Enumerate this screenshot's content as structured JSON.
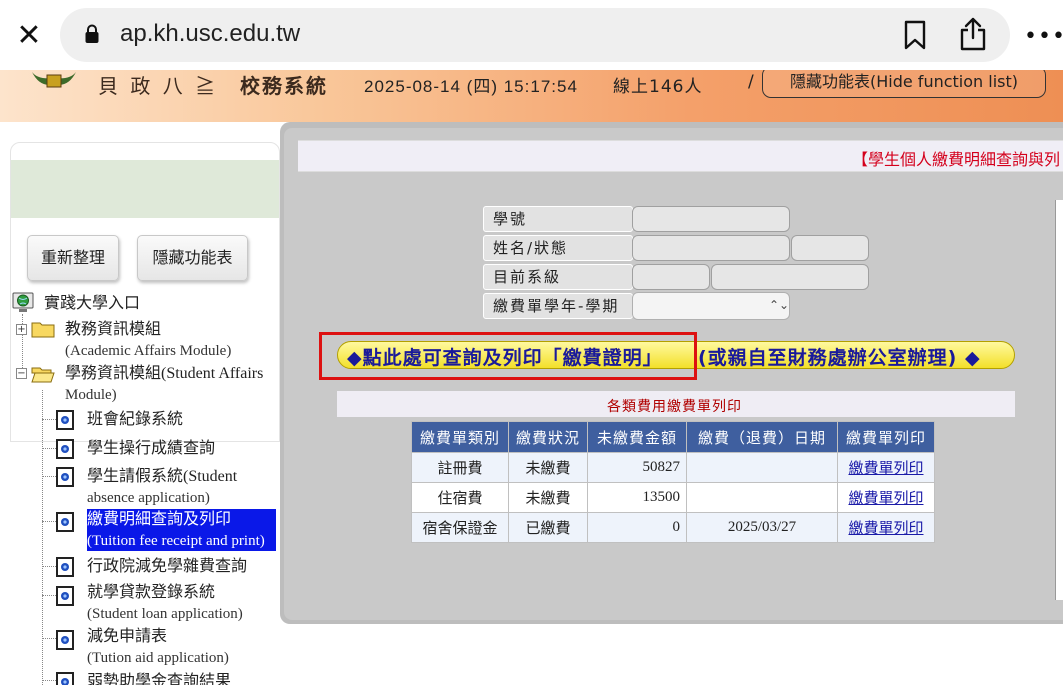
{
  "browser": {
    "url": "ap.kh.usc.edu.tw",
    "close_glyph": "✕",
    "more_glyph": "•••"
  },
  "header": {
    "logo_script": "貝 政 八 ≧",
    "system_name": "校務系統",
    "datetime": "2025-08-14 (四) 15:17:54",
    "online": "線上146人",
    "slash": "/",
    "hide_function_button": "隱藏功能表(Hide function list)"
  },
  "sidebar": {
    "refresh_button": "重新整理",
    "hide_button": "隱藏功能表",
    "root": "實踐大學入口",
    "academic_module": {
      "zh": "教務資訊模組",
      "en": "(Academic Affairs Module)"
    },
    "student_module": {
      "zh": "學務資訊模組(Student Affairs",
      "en": "Module)"
    },
    "items": [
      {
        "zh": "班會紀錄系統",
        "en": ""
      },
      {
        "zh": "學生操行成績查詢",
        "en": ""
      },
      {
        "zh": "學生請假系統(Student",
        "en": "absence application)"
      },
      {
        "zh": "繳費明細查詢及列印",
        "en": "(Tuition fee receipt and print)"
      },
      {
        "zh": "行政院減免學雜費查詢",
        "en": ""
      },
      {
        "zh": "就學貸款登錄系統",
        "en": "(Student loan application)"
      },
      {
        "zh": "減免申請表",
        "en": "(Tution aid application)"
      },
      {
        "zh": "弱勢助學金查詢結果",
        "en": ""
      }
    ]
  },
  "main": {
    "page_title": "【學生個人繳費明細查詢與列",
    "form": {
      "student_id_label": "學號",
      "name_status_label": "姓名/狀態",
      "department_label": "目前系級",
      "term_label": "繳費單學年-學期"
    },
    "certificate_link_part1": "◆點此處可查詢及列印「繳費證明」",
    "certificate_link_part2": "(或親自至財務處辦公室辦理) ◆",
    "print_section_title": "各類費用繳費單列印",
    "table": {
      "headers": [
        "繳費單類別",
        "繳費狀況",
        "未繳費金額",
        "繳費（退費）日期",
        "繳費單列印"
      ],
      "rows": [
        {
          "type": "註冊費",
          "status": "未繳費",
          "amount": "50827",
          "date": "",
          "print": "繳費單列印"
        },
        {
          "type": "住宿費",
          "status": "未繳費",
          "amount": "13500",
          "date": "",
          "print": "繳費單列印"
        },
        {
          "type": "宿舍保證金",
          "status": "已繳費",
          "amount": "0",
          "date": "2025/03/27",
          "print": "繳費單列印"
        }
      ]
    }
  },
  "colors": {
    "header_gradient_end": "#ee8f54",
    "selected_bg": "#0a18e8",
    "table_header_bg": "#3f5f9f",
    "title_red": "#d4001c",
    "highlight_box": "#dd1111",
    "link_yellow": "#f3e02a"
  },
  "icons": {
    "close": "close-icon",
    "lock": "lock-icon",
    "bookmark": "bookmark-icon",
    "share": "share-icon",
    "more": "more-icon",
    "globe": "globe-icon",
    "folder": "folder-icon",
    "document": "document-icon"
  }
}
